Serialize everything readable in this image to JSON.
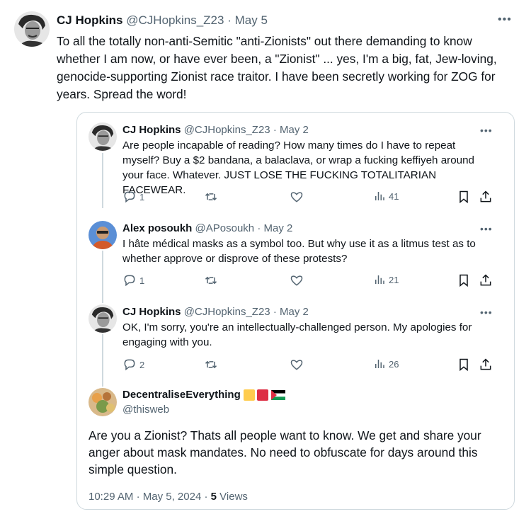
{
  "main_tweet": {
    "name": "CJ Hopkins",
    "handle": "@CJHopkins_Z23",
    "separator": "·",
    "date": "May 5",
    "more": "•••",
    "text": "To all the totally non-anti-Semitic \"anti-Zionists\" out there demanding to know whether I am now, or have ever been, a \"Zionist\" ... yes, I'm a big, fat, Jew-loving, genocide-supporting Zionist race traitor. I have been secretly working for ZOG for years. Spread the word!"
  },
  "thread": [
    {
      "name": "CJ Hopkins",
      "handle": "@CJHopkins_Z23",
      "separator": "·",
      "date": "May 2",
      "more": "•••",
      "text": "Are people incapable of reading? How many times do I have to repeat myself? Buy a $2 bandana, a balaclava, or wrap a fucking keffiyeh around your face. Whatever. JUST LOSE THE FUCKING TOTALITARIAN FACEWEAR.",
      "replies": "1",
      "views": "41"
    },
    {
      "name": "Alex posoukh",
      "handle": "@APosoukh",
      "separator": "·",
      "date": "May 2",
      "more": "•••",
      "text": "I hâte médical masks as a symbol too. But why use it as a litmus test as to whether approve or disprove of these protests?",
      "replies": "1",
      "views": "21"
    },
    {
      "name": "CJ Hopkins",
      "handle": "@CJHopkins_Z23",
      "separator": "·",
      "date": "May 2",
      "more": "•••",
      "text": "OK, I'm sorry, you're an intellectually-challenged person. My apologies for engaging with you.",
      "replies": "2",
      "views": "26"
    }
  ],
  "final_reply": {
    "name": "DecentraliseEverything",
    "handle": "@thisweb",
    "text": "Are you a Zionist?  Thats all people want to know.  We get and share your anger about mask mandates. No need to obfuscate for days around this simple question.",
    "time": "10:29 AM",
    "separator": "·",
    "date": "May 5, 2024",
    "views_count": "5",
    "views_label": "Views"
  },
  "colors": {
    "text": "#0f1419",
    "secondary": "#536471",
    "border": "#cfd9de",
    "flag_yellow": "#ffcc4d",
    "flag_red": "#dd2e44"
  },
  "icons": [
    "reply-icon",
    "retweet-icon",
    "like-icon",
    "views-icon",
    "bookmark-icon",
    "share-icon",
    "more-icon",
    "palestine-flag-icon"
  ]
}
